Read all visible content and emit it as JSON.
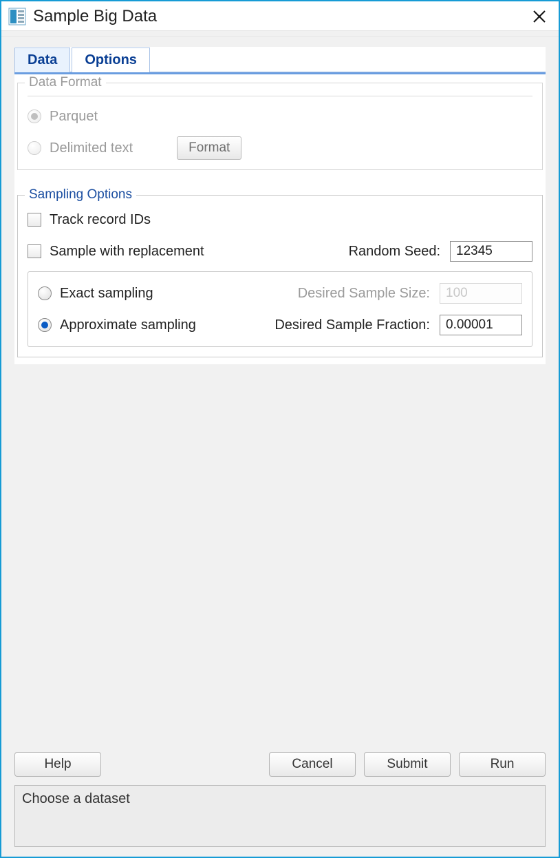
{
  "window": {
    "title": "Sample Big Data"
  },
  "tabs": {
    "data": "Data",
    "options": "Options"
  },
  "dataFormat": {
    "legend": "Data Format",
    "parquet": "Parquet",
    "delimited": "Delimited text",
    "formatButton": "Format"
  },
  "sampling": {
    "legend": "Sampling Options",
    "trackIds": "Track record IDs",
    "withReplacement": "Sample with replacement",
    "randomSeedLabel": "Random Seed:",
    "randomSeedValue": "12345",
    "exact": "Exact sampling",
    "desiredSizeLabel": "Desired Sample Size:",
    "desiredSizeValue": "100",
    "approx": "Approximate sampling",
    "desiredFractionLabel": "Desired Sample Fraction:",
    "desiredFractionValue": "0.00001"
  },
  "buttons": {
    "help": "Help",
    "cancel": "Cancel",
    "submit": "Submit",
    "run": "Run"
  },
  "status": {
    "message": "Choose a dataset"
  }
}
